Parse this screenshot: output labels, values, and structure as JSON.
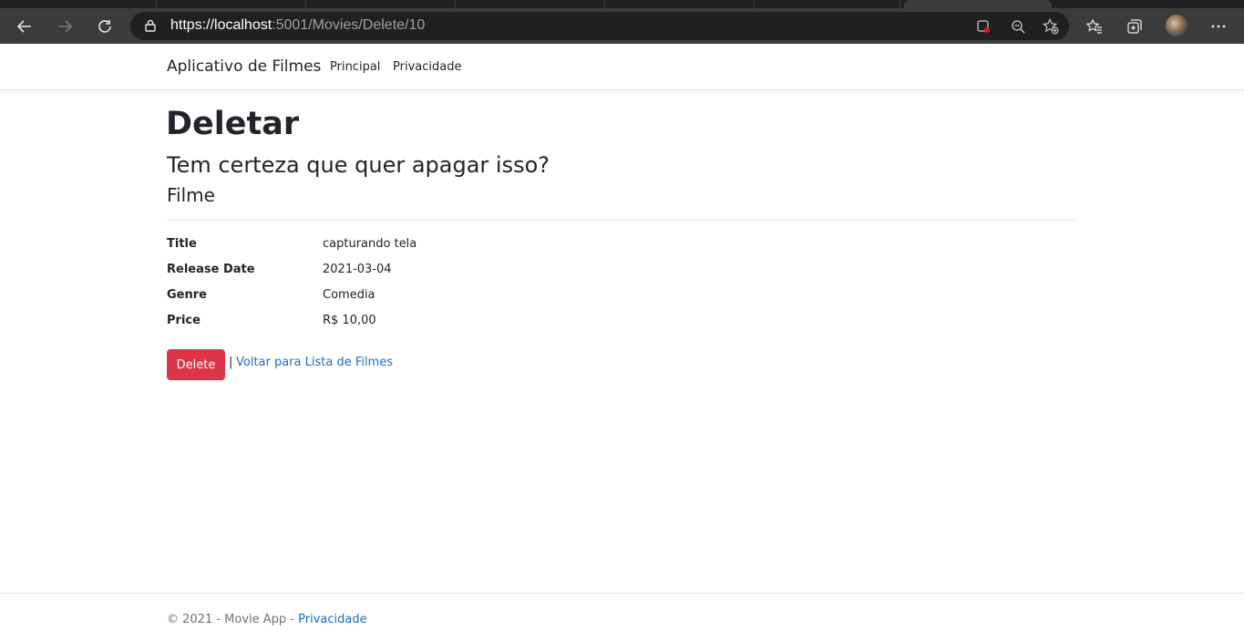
{
  "browser": {
    "url_scheme_host": "https://localhost",
    "url_rest": ":5001/Movies/Delete/10"
  },
  "navbar": {
    "brand": "Aplicativo de Filmes",
    "links": [
      "Principal",
      "Privacidade"
    ]
  },
  "content": {
    "title": "Deletar",
    "question": "Tem certeza que quer apagar isso?",
    "section": "Filme",
    "details": [
      {
        "term": "Title",
        "value": "capturando tela"
      },
      {
        "term": "Release Date",
        "value": "2021-03-04"
      },
      {
        "term": "Genre",
        "value": "Comedia"
      },
      {
        "term": "Price",
        "value": "R$ 10,00"
      }
    ],
    "delete_label": "Delete",
    "separator": "|",
    "back_label": "Voltar para Lista de Filmes"
  },
  "footer": {
    "text": "© 2021 - Movie App - ",
    "link": "Privacidade"
  },
  "colors": {
    "danger": "#dc3545",
    "link": "#1a6fc9"
  }
}
